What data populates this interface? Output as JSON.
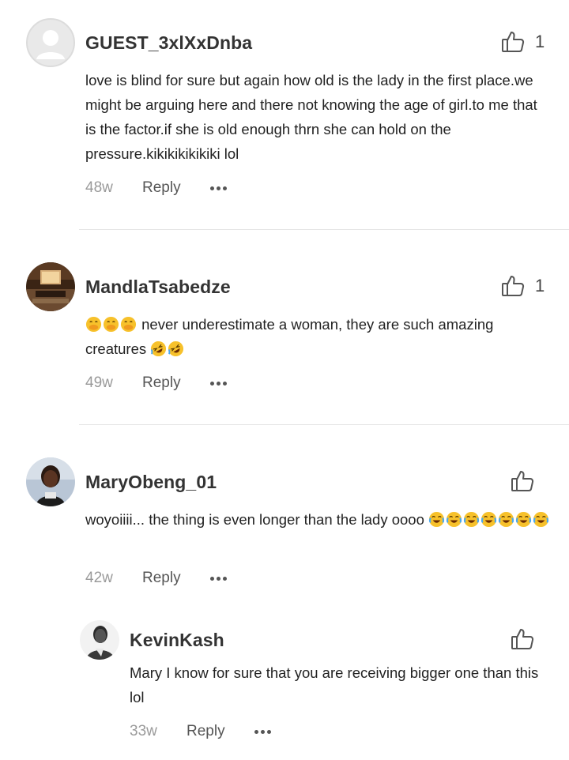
{
  "comments": [
    {
      "username": "GUEST_3xlXxDnba",
      "likes": "1",
      "text": "love is blind for sure but again how old is the lady in the first place.we might be arguing here and there not knowing the age of girl.to me that is the factor.if she is old enough thrn she can hold on the pressure.kikikikikikiki  lol",
      "age": "48w",
      "reply_label": "Reply",
      "avatar_icon": "default-avatar-icon"
    },
    {
      "username": "MandlaTsabedze",
      "likes": "1",
      "text_prefix_emojis": [
        "face-with-hand-over-mouth",
        "face-with-hand-over-mouth",
        "face-with-hand-over-mouth"
      ],
      "text": "never underestimate a woman, they are such amazing creatures",
      "text_suffix_emojis": [
        "rolling-on-floor-laughing",
        "rolling-on-floor-laughing"
      ],
      "age": "49w",
      "reply_label": "Reply",
      "avatar_icon": "room-photo-avatar"
    },
    {
      "username": "MaryObeng_01",
      "likes": "",
      "text": "woyoiiii... the thing is even longer than the lady oooo",
      "text_suffix_emojis": [
        "tears-of-joy",
        "tears-of-joy",
        "tears-of-joy",
        "tears-of-joy",
        "tears-of-joy",
        "tears-of-joy",
        "tears-of-joy"
      ],
      "age": "42w",
      "reply_label": "Reply",
      "avatar_icon": "woman-photo-avatar"
    },
    {
      "username": "KevinKash",
      "likes": "",
      "text": "Mary I know for sure that you are receiving bigger one than this lol",
      "age": "33w",
      "reply_label": "Reply",
      "avatar_icon": "man-photo-avatar",
      "is_reply": true
    }
  ],
  "icons": {
    "like": "thumbs-up-icon",
    "more": "more-options-icon"
  },
  "colors": {
    "username": "#333333",
    "meta_age": "#9a9a9a",
    "divider": "#e6e6e6"
  }
}
